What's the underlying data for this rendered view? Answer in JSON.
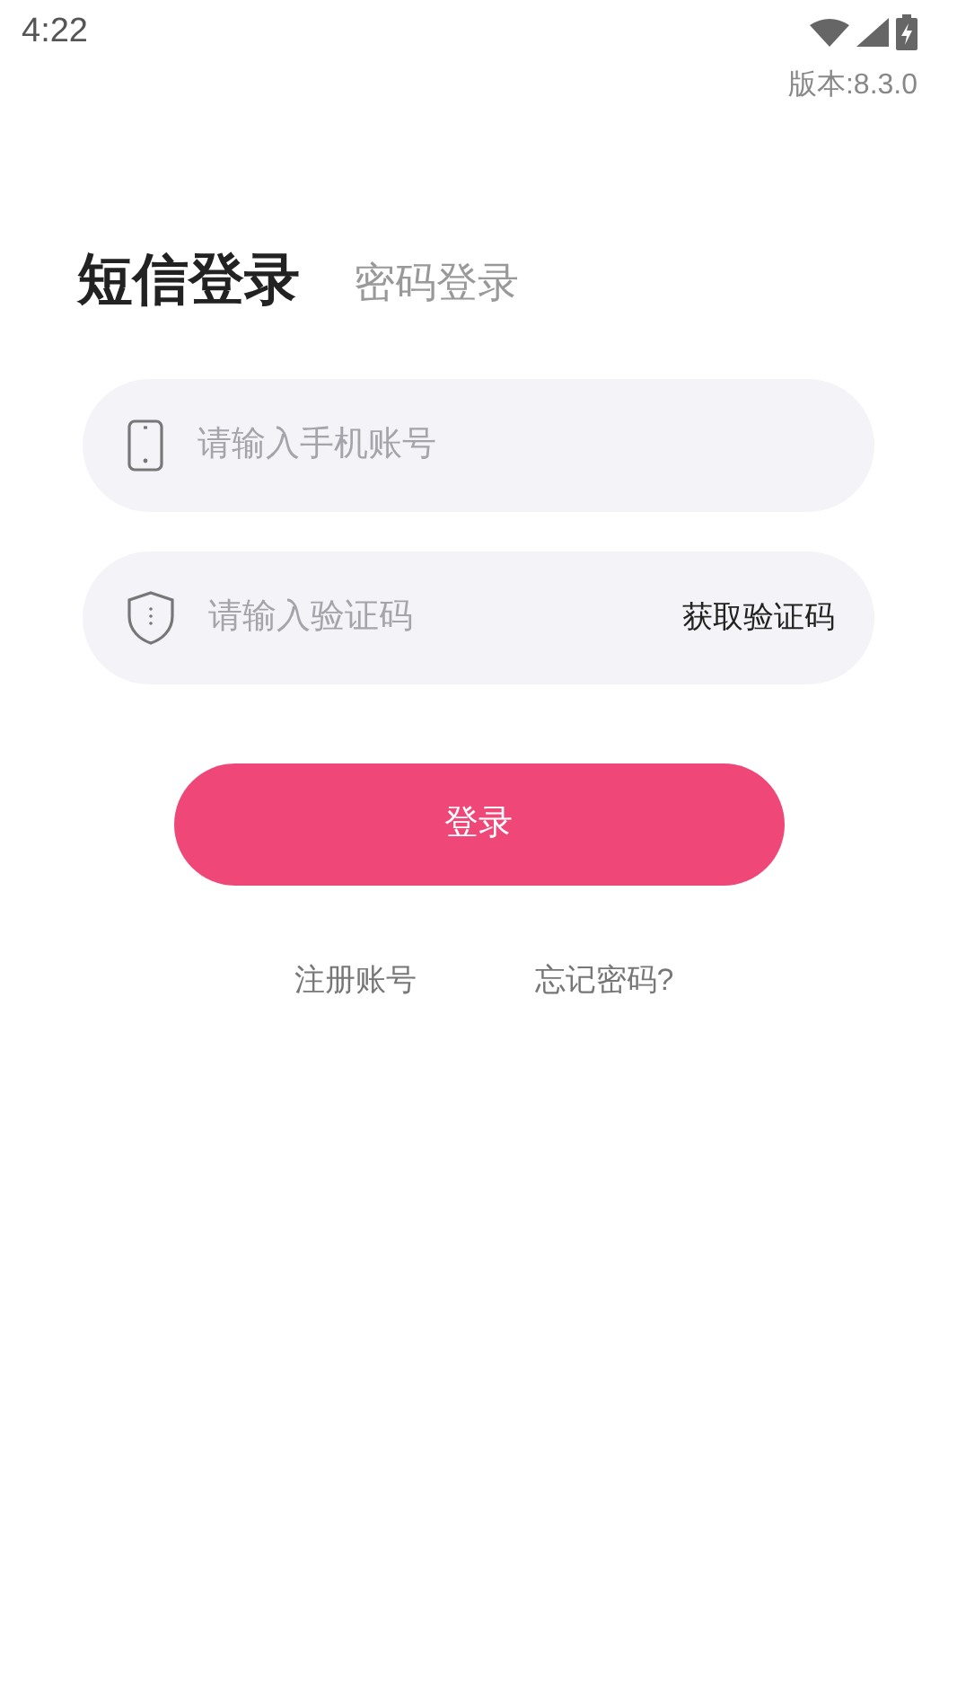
{
  "status_bar": {
    "time": "4:22"
  },
  "version": "版本:8.3.0",
  "tabs": [
    {
      "label": "短信登录",
      "selected": true
    },
    {
      "label": "密码登录",
      "selected": false
    }
  ],
  "fields": [
    {
      "kind": "phone",
      "placeholder": "请输入手机账号"
    },
    {
      "kind": "code",
      "placeholder": "请输入验证码",
      "action": "获取验证码"
    }
  ],
  "login_button": "登录",
  "links": [
    "注册账号",
    "忘记密码?"
  ]
}
